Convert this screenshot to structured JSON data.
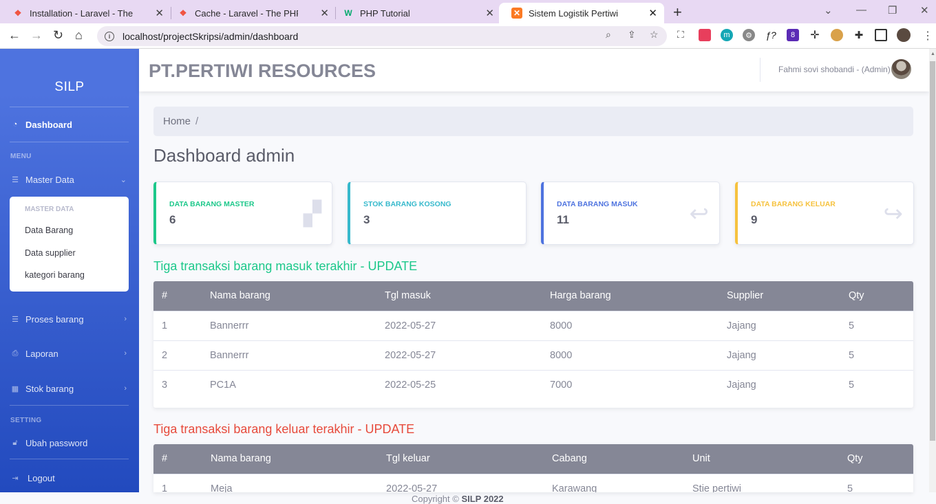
{
  "browser": {
    "tabs": [
      {
        "title": "Installation - Laravel - The PHP Framework",
        "icon": "laravel-icon"
      },
      {
        "title": "Cache - Laravel - The PHP Framework",
        "icon": "laravel-icon"
      },
      {
        "title": "PHP Tutorial",
        "icon": "w3schools-icon"
      },
      {
        "title": "Sistem Logistik Pertiwi",
        "icon": "xampp-icon"
      }
    ],
    "url": "localhost/projectSkripsi/admin/dashboard"
  },
  "sidebar": {
    "brand": "SILP",
    "dashboard": "Dashboard",
    "menu_heading": "MENU",
    "master_data": "Master Data",
    "submenu_heading": "MASTER DATA",
    "submenu": [
      "Data Barang",
      "Data supplier",
      "kategori barang"
    ],
    "proses_barang": "Proses barang",
    "laporan": "Laporan",
    "stok_barang": "Stok barang",
    "setting_heading": "SETTING",
    "ubah_password": "Ubah password",
    "logout": "Logout"
  },
  "topbar": {
    "company": "PT.PERTIWI RESOURCES",
    "user": "Fahmi sovi shobandi - (Admin)"
  },
  "breadcrumb": {
    "home": "Home",
    "separator": "/"
  },
  "page_title": "Dashboard admin",
  "cards": [
    {
      "label": "DATA BARANG MASTER",
      "value": "6",
      "color": "#1cc88a",
      "icon": "boxes-icon"
    },
    {
      "label": "STOK BARANG KOSONG",
      "value": "3",
      "color": "#36b9cc",
      "icon": ""
    },
    {
      "label": "DATA BARANG MASUK",
      "value": "11",
      "color": "#4e73df",
      "icon": "reply-icon"
    },
    {
      "label": "DATA BARANG KELUAR",
      "value": "9",
      "color": "#f6c23e",
      "icon": "share-icon"
    }
  ],
  "masuk": {
    "title": "Tiga transaksi barang masuk terakhir - UPDATE",
    "color": "#1cc88a",
    "headers": [
      "#",
      "Nama barang",
      "Tgl masuk",
      "Harga barang",
      "Supplier",
      "Qty"
    ],
    "rows": [
      [
        "1",
        "Bannerrr",
        "2022-05-27",
        "8000",
        "Jajang",
        "5"
      ],
      [
        "2",
        "Bannerrr",
        "2022-05-27",
        "8000",
        "Jajang",
        "5"
      ],
      [
        "3",
        "PC1A",
        "2022-05-25",
        "7000",
        "Jajang",
        "5"
      ]
    ]
  },
  "keluar": {
    "title": "Tiga transaksi barang keluar terakhir - UPDATE",
    "color": "#e74a3b",
    "headers": [
      "#",
      "Nama barang",
      "Tgl keluar",
      "Cabang",
      "Unit",
      "Qty"
    ],
    "rows": [
      [
        "1",
        "Meja",
        "2022-05-27",
        "Karawang",
        "Stie pertiwi",
        "5"
      ]
    ]
  },
  "footer": {
    "text": "Copyright © ",
    "brand": "SILP 2022"
  }
}
